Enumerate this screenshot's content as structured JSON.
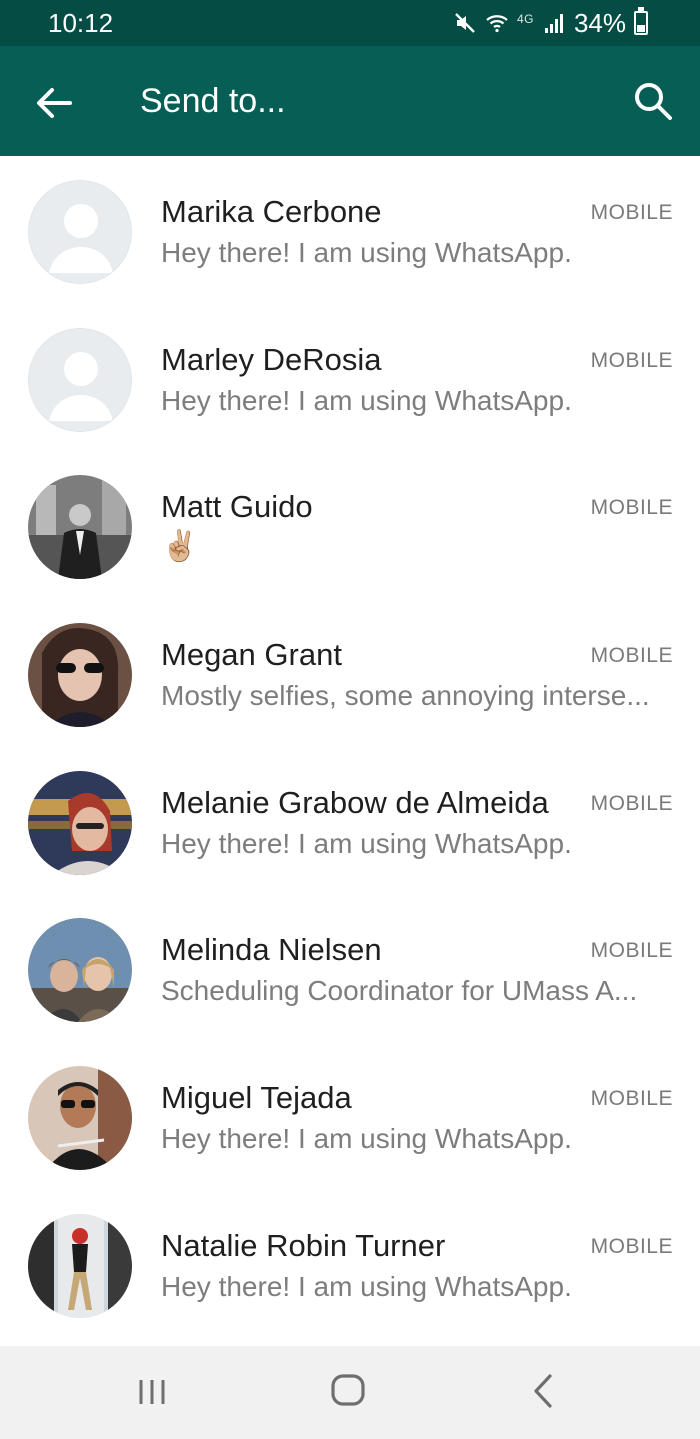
{
  "status_bar": {
    "time": "10:12",
    "network": "4G",
    "battery": "34%",
    "battery_level": 0.34,
    "icons": [
      "mute-icon",
      "wifi-icon",
      "signal-icon",
      "battery-icon"
    ]
  },
  "app_bar": {
    "title": "Send to...",
    "back_icon": "arrow-left-icon",
    "search_icon": "search-icon",
    "background": "#075e54",
    "status_background": "#054d44"
  },
  "contacts": [
    {
      "name": "Marika Cerbone",
      "tag": "MOBILE",
      "about": "Hey there! I am using WhatsApp.",
      "avatar": "placeholder"
    },
    {
      "name": "Marley DeRosia",
      "tag": "MOBILE",
      "about": "Hey there! I am using WhatsApp.",
      "avatar": "placeholder"
    },
    {
      "name": "Matt Guido",
      "tag": "MOBILE",
      "about": "✌🏼",
      "avatar": "photo"
    },
    {
      "name": "Megan Grant",
      "tag": "MOBILE",
      "about": "Mostly selfies, some annoying interse...",
      "avatar": "photo"
    },
    {
      "name": "Melanie Grabow de Almeida",
      "tag": "MOBILE",
      "about": "Hey there! I am using WhatsApp.",
      "avatar": "photo"
    },
    {
      "name": "Melinda Nielsen",
      "tag": "MOBILE",
      "about": "Scheduling Coordinator for UMass A...",
      "avatar": "photo"
    },
    {
      "name": "Miguel Tejada",
      "tag": "MOBILE",
      "about": "Hey there! I am using WhatsApp.",
      "avatar": "photo"
    },
    {
      "name": "Natalie Robin Turner",
      "tag": "MOBILE",
      "about": "Hey there! I am using WhatsApp.",
      "avatar": "photo"
    }
  ],
  "nav_bar": {
    "recents_icon": "recents-icon",
    "home_icon": "home-icon",
    "back_icon": "back-icon"
  }
}
